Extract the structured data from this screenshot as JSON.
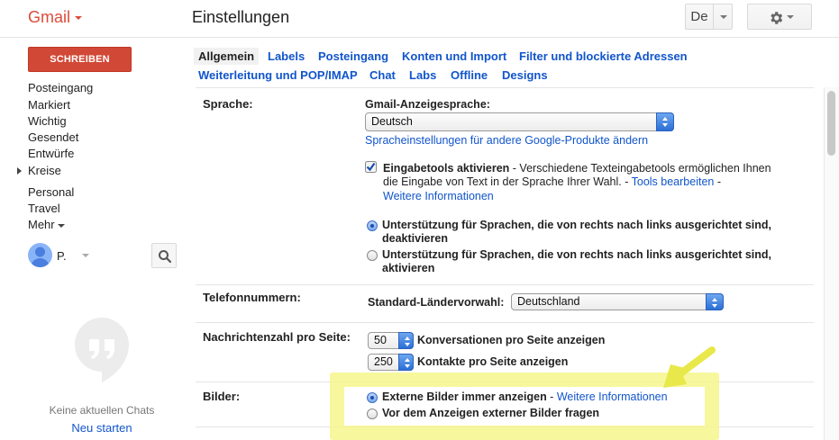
{
  "header": {
    "logo": "Gmail",
    "title": "Einstellungen",
    "lang_label": "De"
  },
  "sidebar": {
    "compose_label": "SCHREIBEN",
    "items": [
      "Posteingang",
      "Markiert",
      "Wichtig",
      "Gesendet",
      "Entwürfe",
      "Kreise",
      "Personal",
      "Travel"
    ],
    "more_label": "Mehr",
    "account_name": "P.",
    "no_chats": "Keine aktuellen Chats",
    "restart": "Neu starten"
  },
  "tabs": {
    "row1": [
      "Allgemein",
      "Labels",
      "Posteingang",
      "Konten und Import",
      "Filter und blockierte Adressen"
    ],
    "row2": [
      "Weiterleitung und POP/IMAP",
      "Chat",
      "Labs",
      "Offline",
      "Designs"
    ],
    "active": "Allgemein"
  },
  "settings": {
    "language": {
      "label": "Sprache:",
      "display_lang_label": "Gmail-Anzeigesprache:",
      "display_lang_value": "Deutsch",
      "other_products_link": "Spracheinstellungen für andere Google-Produkte ändern",
      "input_tools_bold": "Eingabetools aktivieren",
      "input_tools_text1": " - Verschiedene Texteingabetools ermöglichen Ihnen",
      "input_tools_text2": "die Eingabe von Text in der Sprache Ihrer Wahl. - ",
      "edit_tools_link": "Tools bearbeiten",
      "dash": " -",
      "more_info_link": "Weitere Informationen",
      "rtl_off_1": "Unterstützung für Sprachen, die von rechts nach links ausgerichtet sind,",
      "rtl_off_2": "deaktivieren",
      "rtl_on_1": "Unterstützung für Sprachen, die von rechts nach links ausgerichtet sind,",
      "rtl_on_2": "aktivieren"
    },
    "phone": {
      "label": "Telefonnummern:",
      "country_code_label": "Standard-Ländervorwahl:",
      "country_value": "Deutschland"
    },
    "page_size": {
      "label": "Nachrichtenzahl pro Seite:",
      "conversations_value": "50",
      "conversations_text": "Konversationen pro Seite anzeigen",
      "contacts_value": "250",
      "contacts_text": "Kontakte pro Seite anzeigen"
    },
    "images": {
      "label": "Bilder:",
      "always_show": "Externe Bilder immer anzeigen",
      "dash": " - ",
      "more_info_link": "Weitere Informationen",
      "ask_before": "Vor dem Anzeigen externer Bilder fragen"
    }
  },
  "colors": {
    "brand_red": "#dd4b39",
    "link_blue": "#1155cc",
    "highlight_yellow": "#f6f68c"
  }
}
